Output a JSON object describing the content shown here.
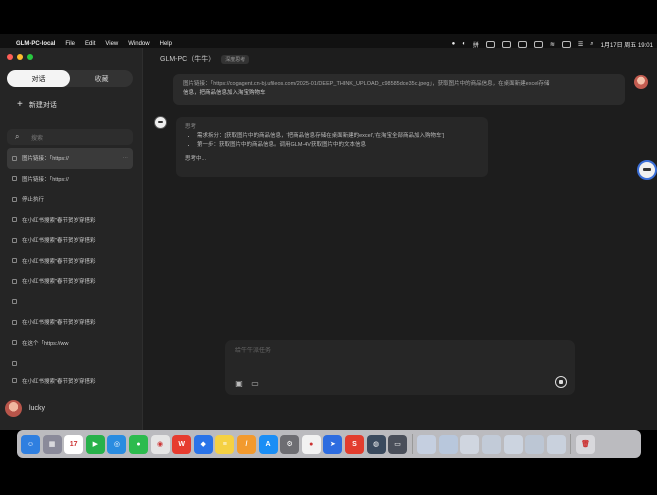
{
  "menubar": {
    "app_name": "GLM-PC-local",
    "menus": [
      "File",
      "Edit",
      "View",
      "Window",
      "Help"
    ],
    "input_method": "拼",
    "date_time": "1月17日 周五 19:01"
  },
  "sidebar": {
    "tabs": [
      "对话",
      "收藏"
    ],
    "active_tab": "对话",
    "new_chat_label": "新建对话",
    "search_placeholder": "搜索",
    "history": [
      {
        "label": "图片链接：「https://",
        "selected": true,
        "more": "···"
      },
      {
        "label": "图片链接：「https://",
        "selected": false
      },
      {
        "label": "停止执行",
        "selected": false
      },
      {
        "label": "在小红书搜索\"春节贺岁穿搭彩",
        "selected": false
      },
      {
        "label": "在小红书搜索\"春节贺岁穿搭彩",
        "selected": false
      },
      {
        "label": "在小红书搜索\"春节贺岁穿搭彩",
        "selected": false
      },
      {
        "label": "在小红书搜索\"春节贺岁穿搭彩",
        "selected": false
      },
      {
        "label": "",
        "selected": false
      },
      {
        "label": "在小红书搜索\"春节贺岁穿搭彩",
        "selected": false
      },
      {
        "label": "在这个「https://ww",
        "selected": false
      },
      {
        "label": "",
        "selected": false
      },
      {
        "label": "在小红书搜索\"春节贺岁穿搭彩",
        "selected": false
      }
    ],
    "user_name": "lucky"
  },
  "main": {
    "title": "GLM-PC（牛牛）",
    "badge": "深度思考",
    "user_message_line1": "图片链接：「https://cogagent.cn-bj.ufileos.com/2025-01/DEEP_THINK_UPLOAD_c98585dce35c.jpeg」，获取图片中的商品信息，在桌面新建excel存储",
    "user_message_line2": "信息，把商品信息加入淘宝购物车",
    "thinking_header": "思考",
    "thinking_items": [
      "需求拆分：[获取图片中的商品信息，'把商品信息存储在桌面新建的excel','在淘宝全部商品加入购物车']",
      "第一步：获取图片中的商品信息。调用GLM-4V获取图片中的文本信息"
    ],
    "thinking_status": "思考中...",
    "composer_placeholder": "给牛牛派任务"
  },
  "dock": {
    "apps": [
      {
        "icon": "finder-icon",
        "color": "#2f7fe0",
        "glyph": "☺"
      },
      {
        "icon": "launchpad-icon",
        "color": "#8a8a9a",
        "glyph": "▦"
      },
      {
        "icon": "calendar-icon",
        "color": "#ffffff",
        "glyph": "17"
      },
      {
        "icon": "facetime-icon",
        "color": "#27b14a",
        "glyph": "▶"
      },
      {
        "icon": "safari-icon",
        "color": "#2a8ce0",
        "glyph": "◎"
      },
      {
        "icon": "wechat-icon",
        "color": "#2dbb4e",
        "glyph": "●"
      },
      {
        "icon": "chrome-icon",
        "color": "#e5e5e5",
        "glyph": "◉"
      },
      {
        "icon": "wps-icon",
        "color": "#e63b2e",
        "glyph": "W"
      },
      {
        "icon": "feishu-icon",
        "color": "#2a73e8",
        "glyph": "◆"
      },
      {
        "icon": "notes-icon",
        "color": "#f5d143",
        "glyph": "≡"
      },
      {
        "icon": "pencil-icon",
        "color": "#f29a2e",
        "glyph": "/"
      },
      {
        "icon": "appstore-icon",
        "color": "#1a8ef5",
        "glyph": "A"
      },
      {
        "icon": "settings-icon",
        "color": "#6d6d72",
        "glyph": "⚙"
      },
      {
        "icon": "glm-app-icon",
        "color": "#f2f2f2",
        "glyph": "●"
      },
      {
        "icon": "navigator-icon",
        "color": "#2d6ce0",
        "glyph": "➤"
      },
      {
        "icon": "slides-icon",
        "color": "#e23d2e",
        "glyph": "S"
      },
      {
        "icon": "screen-icon",
        "color": "#3a4a5e",
        "glyph": "◍"
      },
      {
        "icon": "monitor-icon",
        "color": "#4a4f5a",
        "glyph": "▭"
      },
      {
        "icon": "window-1-icon",
        "color": "#c5cfe0",
        "glyph": ""
      },
      {
        "icon": "window-2-icon",
        "color": "#b8c7dc",
        "glyph": ""
      },
      {
        "icon": "window-3-icon",
        "color": "#d0d6e0",
        "glyph": ""
      },
      {
        "icon": "window-4-icon",
        "color": "#c2cbd8",
        "glyph": ""
      },
      {
        "icon": "window-5-icon",
        "color": "#ccd4e0",
        "glyph": ""
      },
      {
        "icon": "window-6-icon",
        "color": "#bcc6d4",
        "glyph": ""
      },
      {
        "icon": "window-7-icon",
        "color": "#c9d1dd",
        "glyph": ""
      },
      {
        "icon": "trash-icon",
        "color": "#d8d8dc",
        "glyph": "🗑"
      }
    ]
  }
}
